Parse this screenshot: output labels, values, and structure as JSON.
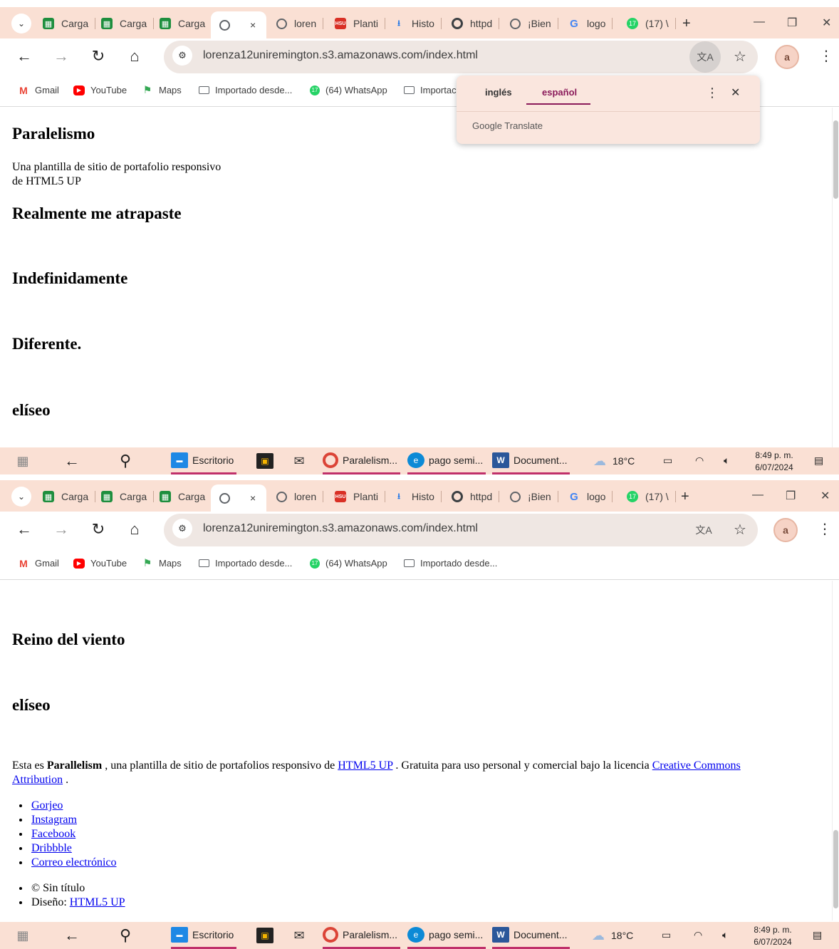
{
  "browser": {
    "tabs": [
      {
        "label": "Carga",
        "icon": "sheets-icon"
      },
      {
        "label": "Carga",
        "icon": "sheets-icon"
      },
      {
        "label": "Carga",
        "icon": "sheets-icon"
      },
      {
        "label": "",
        "icon": "globe-icon",
        "active": true,
        "close": "×"
      },
      {
        "label": "loren",
        "icon": "globe-icon"
      },
      {
        "label": "Planti",
        "icon": "hsu-icon"
      },
      {
        "label": "Histo",
        "icon": "download-icon"
      },
      {
        "label": "httpd",
        "icon": "chrome-icon"
      },
      {
        "label": "¡Bien",
        "icon": "globe-icon"
      },
      {
        "label": "logo",
        "icon": "google-icon"
      },
      {
        "label": "(17) \\",
        "icon": "whatsapp-icon"
      }
    ],
    "new_tab": "+",
    "window": {
      "minimize": "—",
      "restore": "❐",
      "close": "✕"
    },
    "url": "lorenza12uniremington.s3.amazonaws.com/index.html",
    "bookmarks": [
      {
        "label": "Gmail",
        "icon": "gmail-icon"
      },
      {
        "label": "YouTube",
        "icon": "youtube-icon"
      },
      {
        "label": "Maps",
        "icon": "maps-icon"
      },
      {
        "label": "Importado desde...",
        "icon": "folder-icon"
      },
      {
        "label": "(64) WhatsApp",
        "icon": "whatsapp-icon"
      },
      {
        "label": "Importado desde...",
        "icon": "folder-icon"
      }
    ],
    "bookmark_truncated_top": "Importac"
  },
  "translate_popup": {
    "source_lang": "inglés",
    "target_lang": "español",
    "brand": "Google Translate"
  },
  "page_top": {
    "title": "Paralelismo",
    "subtitle_line1": "Una plantilla de sitio de portafolio responsivo",
    "subtitle_line2": "de HTML5 UP",
    "headings": [
      "Realmente me atrapaste",
      "Indefinidamente",
      "Diferente.",
      "elíseo"
    ]
  },
  "page_bottom": {
    "headings": [
      "Reino del viento",
      "elíseo"
    ],
    "credit": {
      "prefix": "Esta es ",
      "name": "Parallelism",
      "middle": " , una plantilla de sitio de portafolios responsivo de ",
      "link1": "HTML5 UP",
      "middle2": " . Gratuita para uso personal y comercial bajo la licencia ",
      "link2_line1": "Creative Commons",
      "link2_line2": "Attribution",
      "suffix": " ."
    },
    "social_links": [
      "Gorjeo",
      "Instagram",
      "Facebook",
      "Dribbble",
      "Correo electrónico"
    ],
    "footer_copyright": "© Sin título",
    "footer_design_prefix": "Diseño: ",
    "footer_design_link": "HTML5 UP"
  },
  "taskbar": {
    "apps": [
      {
        "label": "Escritorio",
        "icon": "desktop-icon"
      },
      {
        "label": "Paralelism...",
        "icon": "chrome-icon"
      },
      {
        "label": "pago semi...",
        "icon": "edge-icon"
      },
      {
        "label": "Document...",
        "icon": "word-icon"
      }
    ],
    "weather": "18°C",
    "time": "8:49 p. m.",
    "date": "6/07/2024"
  },
  "colors": {
    "tabstrip_bg": "#fae0d4",
    "link": "#0000ee",
    "accent_translate": "#8a1a5a"
  }
}
